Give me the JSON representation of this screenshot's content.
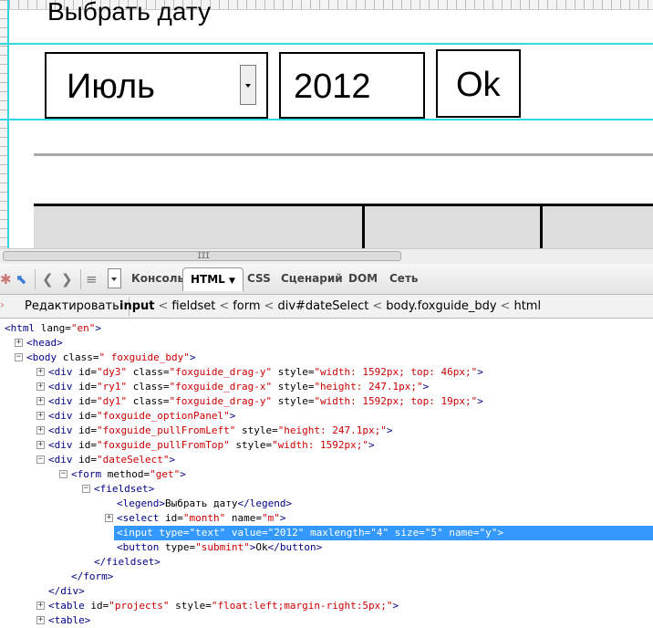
{
  "page": {
    "legend": "Выбрать дату",
    "month_select": "Июль",
    "year_input": "2012",
    "ok_button": "Ok"
  },
  "toolbar": {
    "tabs": [
      "Консоль",
      "HTML",
      "CSS",
      "Сценарий",
      "DOM",
      "Сеть"
    ],
    "active_tab": "HTML",
    "icons": [
      "inspect-icon",
      "back-icon",
      "forward-icon",
      "list-icon",
      "dropdown-icon"
    ]
  },
  "breadcrumb": {
    "edit_button": "Редактировать",
    "items": [
      "input",
      "fieldset",
      "form",
      "div#dateSelect",
      "body.foxguide_bdy",
      "html"
    ],
    "separator": "<"
  },
  "tree": {
    "r0": {
      "t": "<html ",
      "a": "lang=",
      "v": "\"en\"",
      "e": ">"
    },
    "r1": {
      "t": "<head>"
    },
    "r2": {
      "t": "<body ",
      "a": "class=",
      "v": "\" foxguide_bdy\"",
      "e": ">"
    },
    "r3": {
      "t": "<div ",
      "a1": "id=",
      "v1": "\"dy3\"",
      "a2": " class=",
      "v2": "\"foxguide_drag-y\"",
      "a3": " style=",
      "v3": "\"width: 1592px; top: 46px;\"",
      "e": ">"
    },
    "r4": {
      "t": "<div ",
      "a1": "id=",
      "v1": "\"ry1\"",
      "a2": " class=",
      "v2": "\"foxguide_drag-x\"",
      "a3": " style=",
      "v3": "\"height: 247.1px;\"",
      "e": ">"
    },
    "r5": {
      "t": "<div ",
      "a1": "id=",
      "v1": "\"dy1\"",
      "a2": " class=",
      "v2": "\"foxguide_drag-y\"",
      "a3": " style=",
      "v3": "\"width: 1592px; top: 19px;\"",
      "e": ">"
    },
    "r6": {
      "t": "<div ",
      "a": "id=",
      "v": "\"foxguide_optionPanel\"",
      "e": ">"
    },
    "r7": {
      "t": "<div ",
      "a1": "id=",
      "v1": "\"foxguide_pullFromLeft\"",
      "a2": " style=",
      "v2": "\"height: 247.1px;\"",
      "e": ">"
    },
    "r8": {
      "t": "<div ",
      "a1": "id=",
      "v1": "\"foxguide_pullFromTop\"",
      "a2": " style=",
      "v2": "\"width: 1592px;\"",
      "e": ">"
    },
    "r9": {
      "t": "<div ",
      "a": "id=",
      "v": "\"dateSelect\"",
      "e": ">"
    },
    "r10": {
      "t": "<form ",
      "a": "method=",
      "v": "\"get\"",
      "e": ">"
    },
    "r11": {
      "t": "<fieldset>"
    },
    "r12": {
      "t": "<legend>",
      "x": "Выбрать дату",
      "e": "</legend>"
    },
    "r13": {
      "t": "<select ",
      "a1": "id=",
      "v1": "\"month\"",
      "a2": " name=",
      "v2": "\"m\"",
      "e": ">"
    },
    "r14": {
      "t": "<input ",
      "a1": "type=",
      "v1": "\"text\"",
      "a2": " value=",
      "v2": "\"2012\"",
      "a3": " maxlength=",
      "v3": "\"4\"",
      "a4": " size=",
      "v4": "\"5\"",
      "a5": " name=",
      "v5": "\"y\"",
      "e": ">"
    },
    "r15": {
      "t": "<button ",
      "a": "type=",
      "v": "\"submint\"",
      "e": ">",
      "x": "Ok",
      "e2": "</button>"
    },
    "r16": {
      "t": "</fieldset>"
    },
    "r17": {
      "t": "</form>"
    },
    "r18": {
      "t": "</div>"
    },
    "r19": {
      "t": "<table ",
      "a1": "id=",
      "v1": "\"projects\"",
      "a2": " style=",
      "v2": "\"float:left;margin-right:5px;\"",
      "e": ">"
    },
    "r20": {
      "t": "<table>"
    }
  },
  "colors": {
    "guide": "#32d6e0",
    "selection": "#3399ff",
    "tag": "#000088",
    "attr_value": "#cc0000"
  }
}
